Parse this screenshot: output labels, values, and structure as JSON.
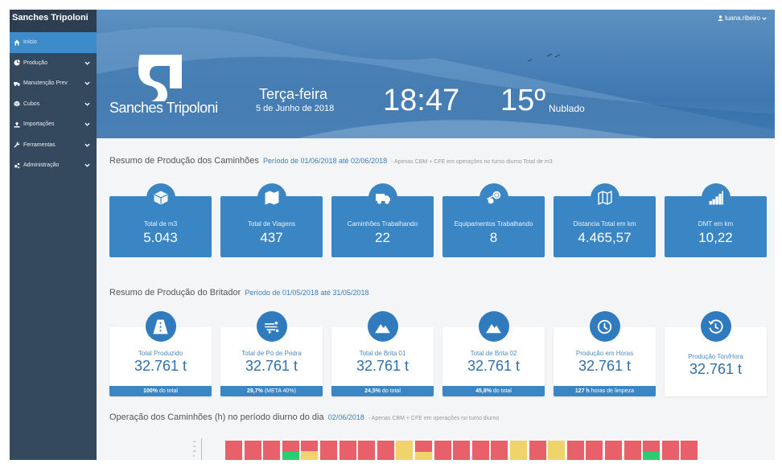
{
  "brand": "Sanches Tripoloni",
  "sidebar": {
    "items": [
      {
        "label": "Início",
        "icon": "home-icon",
        "active": true,
        "expandable": false
      },
      {
        "label": "Produção",
        "icon": "pie-chart-icon",
        "active": false,
        "expandable": true
      },
      {
        "label": "Manutenção Prev",
        "icon": "truck-icon",
        "active": false,
        "expandable": true
      },
      {
        "label": "Cubos",
        "icon": "cube-icon",
        "active": false,
        "expandable": true
      },
      {
        "label": "Importações",
        "icon": "upload-icon",
        "active": false,
        "expandable": true
      },
      {
        "label": "Ferramentas",
        "icon": "wrench-icon",
        "active": false,
        "expandable": true
      },
      {
        "label": "Administração",
        "icon": "cogs-icon",
        "active": false,
        "expandable": true
      }
    ]
  },
  "header": {
    "user": "luana.ribeiro",
    "logo_text": "Sanches Tripoloni",
    "day": "Terça-feira",
    "date": "5 de Junho de 2018",
    "time": "18:47",
    "temperature": "15º",
    "condition": "Nublado"
  },
  "trucks_section": {
    "title": "Resumo de Produção dos Caminhões",
    "period": "Período de 01/06/2018 até 02/06/2018",
    "note": "- Apenas CBM + CFE em operações no turno diurno Total de m3",
    "cards": [
      {
        "label": "Total de m3",
        "value": "5.043",
        "icon": "cube-icon"
      },
      {
        "label": "Total de Viagens",
        "value": "437",
        "icon": "map-icon"
      },
      {
        "label": "Caminhões Trabalhando",
        "value": "22",
        "icon": "truck-icon"
      },
      {
        "label": "Equipamentos Trabalhando",
        "value": "8",
        "icon": "steam-icon"
      },
      {
        "label": "Distancia Total em km",
        "value": "4.465,57",
        "icon": "map-outline-icon"
      },
      {
        "label": "DMT em km",
        "value": "10,22",
        "icon": "signal-bars-icon"
      }
    ]
  },
  "crusher_section": {
    "title": "Resumo de Produção do Britador",
    "period": "Período de 01/05/2018 até 31/05/2018",
    "cards": [
      {
        "label": "Total Produzido",
        "value": "32.761 t",
        "icon": "road-icon",
        "foot_bold": "100%",
        "foot_text": "do total"
      },
      {
        "label": "Total de Pó de Pedra",
        "value": "32.761 t",
        "icon": "dust-icon",
        "foot_bold": "29,7%",
        "foot_text": "(META 40%)"
      },
      {
        "label": "Total de Brita 01",
        "value": "32.761 t",
        "icon": "mountain-icon",
        "foot_bold": "24,5%",
        "foot_text": "do total"
      },
      {
        "label": "Total de Brita 02",
        "value": "32.761 t",
        "icon": "mountain-icon",
        "foot_bold": "45,8%",
        "foot_text": "do total"
      },
      {
        "label": "Produção em Horas",
        "value": "32.761 t",
        "icon": "clock-icon",
        "foot_bold": "127 h",
        "foot_text": "horas de limpeza"
      },
      {
        "label": "Produção Ton/Hora",
        "value": "32.761 t",
        "icon": "clock-history-icon",
        "foot_bold": "",
        "foot_text": ""
      }
    ]
  },
  "operations_section": {
    "title": "Operação dos Caminhões (h) no período diurno do dia",
    "date": "02/06/2018",
    "note": "- Apenas CBM + CFE em operações no turno diurno"
  },
  "colors": {
    "sidebar": "#34495e",
    "active": "#3d8bc9",
    "card_blue": "#3a86c4",
    "bar_red": "#e8606a",
    "bar_yellow": "#efd36b",
    "bar_green": "#2ecc71"
  },
  "chart_data": {
    "type": "bar",
    "y_ticks": [
      "12",
      "11",
      "10",
      "9"
    ],
    "bars": [
      {
        "top": "red",
        "bottom": "red"
      },
      {
        "top": "red",
        "bottom": "red"
      },
      {
        "top": "red",
        "bottom": "red"
      },
      {
        "top": "red",
        "bottom": "green"
      },
      {
        "top": "red",
        "bottom": "yellow"
      },
      {
        "top": "red",
        "bottom": "red"
      },
      {
        "top": "red",
        "bottom": "red"
      },
      {
        "top": "red",
        "bottom": "red"
      },
      {
        "top": "red",
        "bottom": "red"
      },
      {
        "top": "yellow",
        "bottom": "yellow"
      },
      {
        "top": "red",
        "bottom": "yellow"
      },
      {
        "top": "red",
        "bottom": "red"
      },
      {
        "top": "red",
        "bottom": "red"
      },
      {
        "top": "red",
        "bottom": "red"
      },
      {
        "top": "red",
        "bottom": "red"
      },
      {
        "top": "yellow",
        "bottom": "yellow"
      },
      {
        "top": "red",
        "bottom": "red"
      },
      {
        "top": "yellow",
        "bottom": "yellow"
      },
      {
        "top": "red",
        "bottom": "red"
      },
      {
        "top": "red",
        "bottom": "red"
      },
      {
        "top": "red",
        "bottom": "red"
      },
      {
        "top": "red",
        "bottom": "red"
      },
      {
        "top": "red",
        "bottom": "green"
      },
      {
        "top": "red",
        "bottom": "red"
      },
      {
        "top": "red",
        "bottom": "red"
      }
    ]
  }
}
